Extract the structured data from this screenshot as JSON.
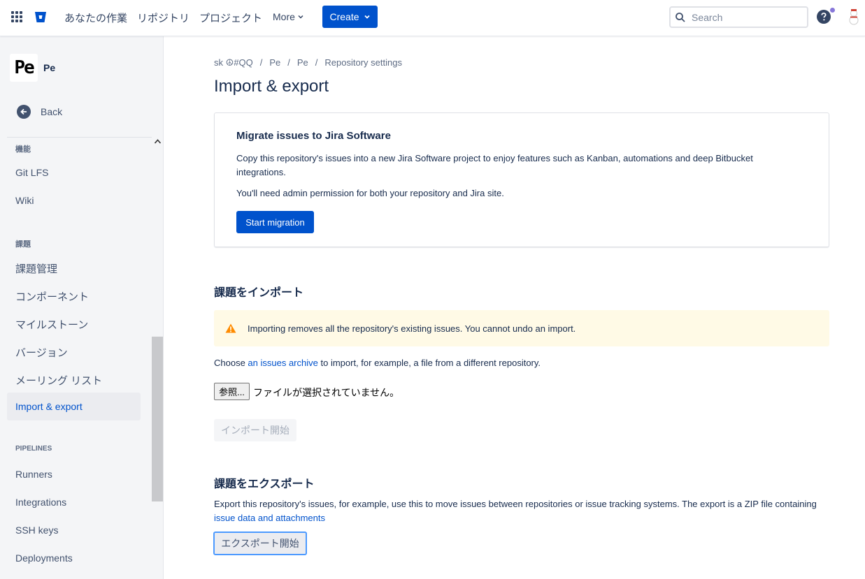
{
  "topnav": {
    "links": [
      "あなたの作業",
      "リポジトリ",
      "プロジェクト"
    ],
    "more_label": "More",
    "create_label": "Create",
    "search_placeholder": "Search"
  },
  "sidebar": {
    "repo_avatar_text": "Pe",
    "repo_name": "Pe",
    "back_label": "Back",
    "sections": [
      {
        "heading": "機能",
        "items": [
          "Git LFS",
          "Wiki"
        ]
      },
      {
        "heading": "課題",
        "items": [
          "課題管理",
          "コンポーネント",
          "マイルストーン",
          "バージョン",
          "メーリング リスト",
          "Import & export"
        ]
      },
      {
        "heading": "PIPELINES",
        "items": [
          "Runners",
          "Integrations",
          "SSH keys",
          "Deployments"
        ]
      }
    ],
    "active_item": "Import & export"
  },
  "breadcrumb": [
    "sk ☮#QQ",
    "/",
    "Pe",
    "/",
    "Pe",
    "/",
    "Repository settings"
  ],
  "page_title": "Import & export",
  "migrate": {
    "title": "Migrate issues to Jira Software",
    "description": "Copy this repository's issues into a new Jira Software project to enjoy features such as Kanban, automations and deep Bitbucket integrations.",
    "permission": "You'll need admin permission for both your repository and Jira site.",
    "button": "Start migration"
  },
  "import": {
    "heading": "課題をインポート",
    "warning": "Importing removes all the repository's existing issues. You cannot undo an import.",
    "choose_prefix": "Choose ",
    "choose_link": "an issues archive",
    "choose_suffix": " to import, for example, a file from a different repository.",
    "file_button": "参照...",
    "file_status": "ファイルが選択されていません。",
    "start_button": "インポート開始"
  },
  "export": {
    "heading": "課題をエクスポート",
    "description": "Export this repository's issues, for example, use this to move issues between repositories or issue tracking systems. The export is a ZIP file containing ",
    "link": "issue data and attachments",
    "button": "エクスポート開始"
  },
  "colors": {
    "brand": "#0052cc",
    "warning_bg": "#fffae6",
    "warning_icon": "#ff8b00"
  }
}
